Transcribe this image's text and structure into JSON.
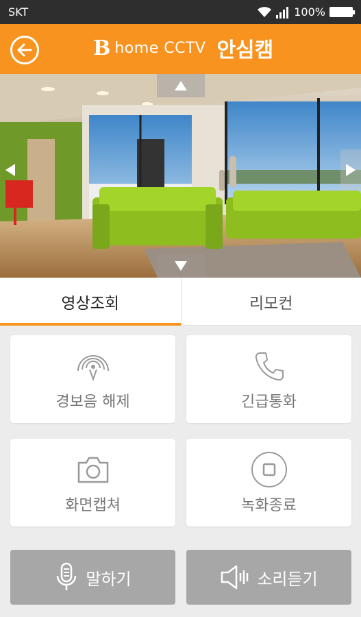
{
  "status": {
    "carrier": "SKT",
    "battery": "100%"
  },
  "header": {
    "brand_letter": "B",
    "brand_sub": "home CCTV",
    "title": "안심캠"
  },
  "tabs": [
    {
      "label": "영상조회",
      "active": true
    },
    {
      "label": "리모컨",
      "active": false
    }
  ],
  "actions": {
    "alarm_off": {
      "label": "경보음 해제",
      "icon": "alarm-waves-icon"
    },
    "emergency_call": {
      "label": "긴급통화",
      "icon": "phone-icon"
    },
    "capture": {
      "label": "화면캡쳐",
      "icon": "camera-icon"
    },
    "stop_recording": {
      "label": "녹화종료",
      "icon": "stop-icon"
    }
  },
  "bottom": {
    "talk": {
      "label": "말하기",
      "icon": "microphone-icon"
    },
    "listen": {
      "label": "소리듣기",
      "icon": "speaker-icon"
    }
  },
  "colors": {
    "accent": "#f7931e",
    "card_label": "#777777",
    "bottom_button": "#a7a7a7"
  }
}
